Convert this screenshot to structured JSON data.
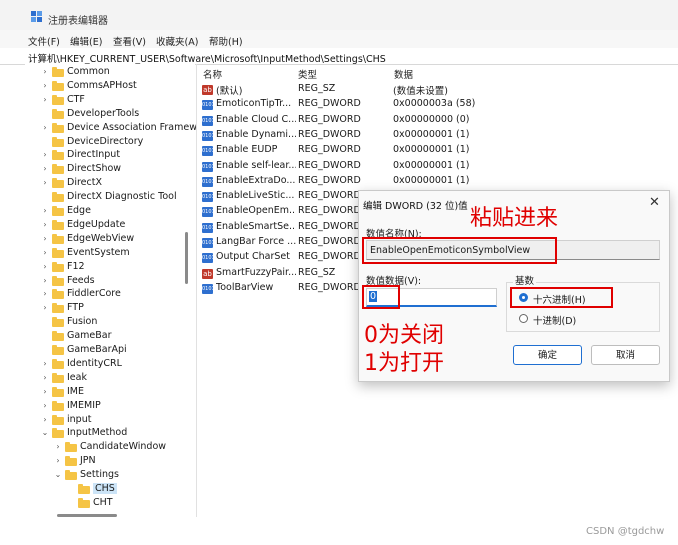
{
  "window": {
    "title": "注册表编辑器",
    "icon": "registry-icon"
  },
  "menu": [
    "文件(F)",
    "编辑(E)",
    "查看(V)",
    "收藏夹(A)",
    "帮助(H)"
  ],
  "address": "计算机\\HKEY_CURRENT_USER\\Software\\Microsoft\\InputMethod\\Settings\\CHS",
  "tree": [
    {
      "label": "Common",
      "chev": ">"
    },
    {
      "label": "CommsAPHost",
      "chev": ">"
    },
    {
      "label": "CTF",
      "chev": ">"
    },
    {
      "label": "DeveloperTools",
      "chev": ""
    },
    {
      "label": "Device Association Framew",
      "chev": ">"
    },
    {
      "label": "DeviceDirectory",
      "chev": ""
    },
    {
      "label": "DirectInput",
      "chev": ">"
    },
    {
      "label": "DirectShow",
      "chev": ">"
    },
    {
      "label": "DirectX",
      "chev": ">"
    },
    {
      "label": "DirectX Diagnostic Tool",
      "chev": ""
    },
    {
      "label": "Edge",
      "chev": ">"
    },
    {
      "label": "EdgeUpdate",
      "chev": ">"
    },
    {
      "label": "EdgeWebView",
      "chev": ">"
    },
    {
      "label": "EventSystem",
      "chev": ">"
    },
    {
      "label": "F12",
      "chev": ">"
    },
    {
      "label": "Feeds",
      "chev": ">"
    },
    {
      "label": "FiddlerCore",
      "chev": ">"
    },
    {
      "label": "FTP",
      "chev": ">"
    },
    {
      "label": "Fusion",
      "chev": ""
    },
    {
      "label": "GameBar",
      "chev": ""
    },
    {
      "label": "GameBarApi",
      "chev": ""
    },
    {
      "label": "IdentityCRL",
      "chev": ">"
    },
    {
      "label": "Ieak",
      "chev": ">"
    },
    {
      "label": "IME",
      "chev": ">"
    },
    {
      "label": "IMEMIP",
      "chev": ">"
    },
    {
      "label": "input",
      "chev": ">"
    },
    {
      "label": "InputMethod",
      "chev": "v"
    },
    {
      "label": "CandidateWindow",
      "chev": ">"
    },
    {
      "label": "JPN",
      "chev": ">"
    },
    {
      "label": "Settings",
      "chev": "v"
    },
    {
      "label": "CHS",
      "chev": ""
    },
    {
      "label": "CHT",
      "chev": ""
    }
  ],
  "list": {
    "headers": {
      "name": "名称",
      "type": "类型",
      "data": "数据"
    },
    "rows": [
      {
        "icon": "string-value-icon",
        "iconText": "ab",
        "kind": "sz",
        "name": "(默认)",
        "type": "REG_SZ",
        "data": "(数值未设置)"
      },
      {
        "icon": "dword-value-icon",
        "iconText": "010\n110",
        "kind": "dw",
        "name": "EmoticonTipTr...",
        "type": "REG_DWORD",
        "data": "0x0000003a (58)"
      },
      {
        "icon": "dword-value-icon",
        "iconText": "010\n110",
        "kind": "dw",
        "name": "Enable Cloud C...",
        "type": "REG_DWORD",
        "data": "0x00000000 (0)"
      },
      {
        "icon": "dword-value-icon",
        "iconText": "010\n110",
        "kind": "dw",
        "name": "Enable Dynami...",
        "type": "REG_DWORD",
        "data": "0x00000001 (1)"
      },
      {
        "icon": "dword-value-icon",
        "iconText": "010\n110",
        "kind": "dw",
        "name": "Enable EUDP",
        "type": "REG_DWORD",
        "data": "0x00000001 (1)"
      },
      {
        "icon": "dword-value-icon",
        "iconText": "010\n110",
        "kind": "dw",
        "name": "Enable self-lear...",
        "type": "REG_DWORD",
        "data": "0x00000001 (1)"
      },
      {
        "icon": "dword-value-icon",
        "iconText": "010\n110",
        "kind": "dw",
        "name": "EnableExtraDo...",
        "type": "REG_DWORD",
        "data": "0x00000001 (1)"
      },
      {
        "icon": "dword-value-icon",
        "iconText": "010\n110",
        "kind": "dw",
        "name": "EnableLiveStic...",
        "type": "REG_DWORD",
        "data": ""
      },
      {
        "icon": "dword-value-icon",
        "iconText": "010\n110",
        "kind": "dw",
        "name": "EnableOpenEm...",
        "type": "REG_DWORD",
        "data": ""
      },
      {
        "icon": "dword-value-icon",
        "iconText": "010\n110",
        "kind": "dw",
        "name": "EnableSmartSe...",
        "type": "REG_DWORD",
        "data": ""
      },
      {
        "icon": "dword-value-icon",
        "iconText": "010\n110",
        "kind": "dw",
        "name": "LangBar Force ...",
        "type": "REG_DWORD",
        "data": ""
      },
      {
        "icon": "dword-value-icon",
        "iconText": "010\n110",
        "kind": "dw",
        "name": "Output CharSet",
        "type": "REG_DWORD",
        "data": ""
      },
      {
        "icon": "string-value-icon",
        "iconText": "ab",
        "kind": "sz",
        "name": "SmartFuzzyPair...",
        "type": "REG_SZ",
        "data": ""
      },
      {
        "icon": "dword-value-icon",
        "iconText": "010\n110",
        "kind": "dw",
        "name": "ToolBarView",
        "type": "REG_DWORD",
        "data": ""
      }
    ]
  },
  "dialog": {
    "title": "编辑 DWORD (32 位)值",
    "name_label": "数值名称(N):",
    "name_value": "EnableOpenEmoticonSymbolView",
    "value_label": "数值数据(V):",
    "value": "0",
    "base_label": "基数",
    "hex_label": "十六进制(H)",
    "dec_label": "十进制(D)",
    "selected_base": "hex",
    "ok_label": "确定",
    "cancel_label": "取消"
  },
  "annotations": {
    "paste": "粘贴进来",
    "close": "0为关闭",
    "open": "1为打开",
    "color": "#e00000"
  },
  "watermark": "CSDN @tgdchw"
}
